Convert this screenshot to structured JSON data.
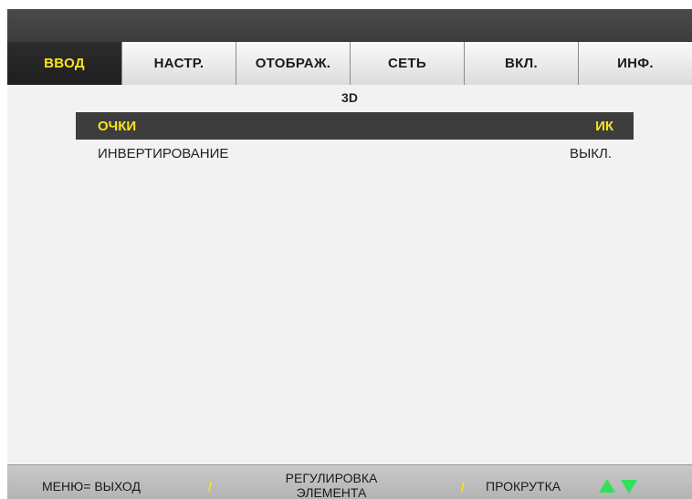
{
  "tabs": [
    {
      "label": "ВВОД",
      "active": true
    },
    {
      "label": "НАСТР.",
      "active": false
    },
    {
      "label": "ОТОБРАЖ.",
      "active": false
    },
    {
      "label": "СЕТЬ",
      "active": false
    },
    {
      "label": "ВКЛ.",
      "active": false
    },
    {
      "label": "ИНФ.",
      "active": false
    }
  ],
  "submenu": {
    "title": "3D"
  },
  "items": [
    {
      "label": "ОЧКИ",
      "value": "ИК",
      "selected": true
    },
    {
      "label": "ИНВЕРТИРОВАНИЕ",
      "value": "ВЫКЛ.",
      "selected": false
    }
  ],
  "footer": {
    "exit": "МЕНЮ= ВЫХОД",
    "separator": "/",
    "adjust_line1": "РЕГУЛИРОВКА",
    "adjust_line2": "ЭЛЕМЕНТА",
    "scroll": "ПРОКРУТКА",
    "arrow_icons": [
      "arrow-up-icon",
      "arrow-down-icon"
    ]
  },
  "colors": {
    "highlight_text": "#f7e51b",
    "arrow": "#33e05a",
    "selected_row_bg": "#3d3d3d",
    "active_tab_bg": "#262626"
  }
}
